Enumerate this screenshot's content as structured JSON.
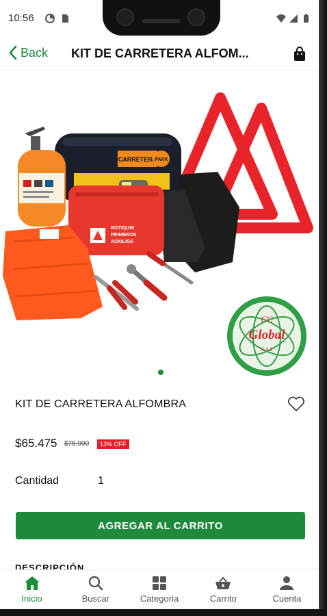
{
  "status_bar": {
    "time": "10:56"
  },
  "header": {
    "back_label": "Back",
    "title": "KIT DE CARRETERA ALFOM..."
  },
  "hero": {
    "logo_lines": [
      "CC",
      "Global",
      "S.A.S"
    ],
    "bag_label": "CARRETERA",
    "bag_sub": "PARK",
    "kit_label_1": "BOTIQUIN",
    "kit_label_2": "PRIMEROS",
    "kit_label_3": "AUXILIOS"
  },
  "carousel": {
    "pages": 1,
    "active": 1
  },
  "product": {
    "name": "KIT DE CARRETERA ALFOMBRA",
    "price": "$65.475",
    "old_price": "$75.000",
    "discount": "13% OFF",
    "quantity_label": "Cantidad",
    "quantity": "1",
    "add_button": "AGREGAR AL CARRITO",
    "description_heading": "DESCRIPCIÓN"
  },
  "colors": {
    "accent": "#1e8a3c",
    "badge": "#e41e26"
  },
  "bottom_nav": [
    {
      "label": "Inicio",
      "icon": "home-icon",
      "active": true
    },
    {
      "label": "Buscar",
      "icon": "search-icon",
      "active": false
    },
    {
      "label": "Categoria",
      "icon": "grid-icon",
      "active": false
    },
    {
      "label": "Carrito",
      "icon": "basket-icon",
      "active": false
    },
    {
      "label": "Cuenta",
      "icon": "person-icon",
      "active": false
    }
  ]
}
